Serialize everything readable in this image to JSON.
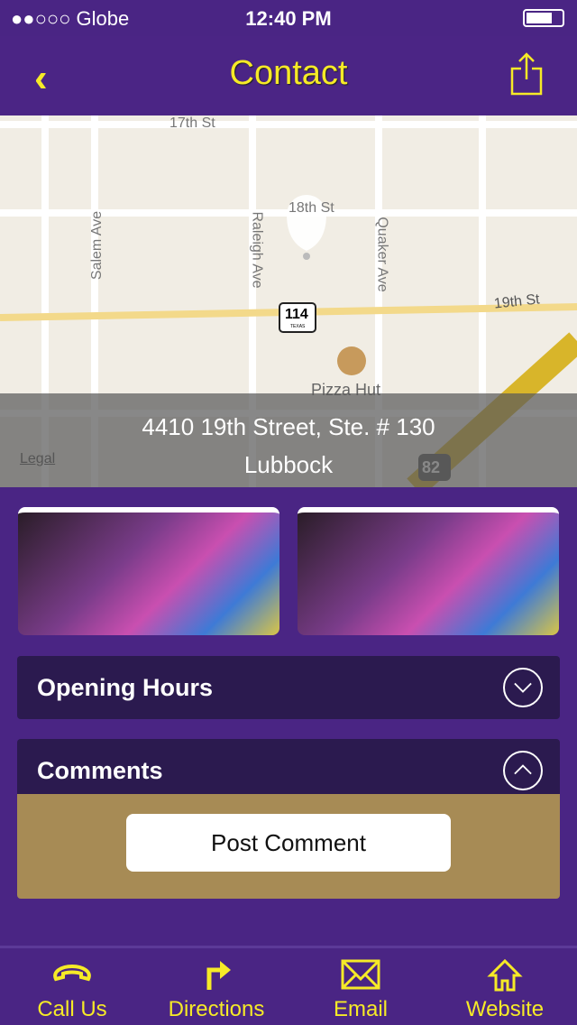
{
  "status": {
    "carrier": "●●○○○ Globe",
    "time": "12:40 PM"
  },
  "nav": {
    "title": "Contact",
    "back_icon": "chevron-left-icon",
    "share_icon": "share-icon"
  },
  "map": {
    "streets": [
      "17th St",
      "18th St",
      "19th St",
      "Salem Ave",
      "Raleigh Ave",
      "Quaker Ave"
    ],
    "highway_shield": "114",
    "highway_state": "TEXAS",
    "us_route": "82",
    "poi": "Pizza Hut",
    "legal": "Legal"
  },
  "address": {
    "line1": "4410 19th Street, Ste. # 130",
    "line2": "Lubbock"
  },
  "sections": {
    "opening_hours": "Opening Hours",
    "comments": "Comments",
    "post_comment": "Post Comment"
  },
  "tabs": [
    {
      "label": "Call Us",
      "icon": "phone-icon"
    },
    {
      "label": "Directions",
      "icon": "turn-right-arrow-icon"
    },
    {
      "label": "Email",
      "icon": "envelope-icon"
    },
    {
      "label": "Website",
      "icon": "home-icon"
    }
  ],
  "colors": {
    "purple": "#4a2584",
    "yellow": "#f6ea27",
    "gold": "#a78b55",
    "dark": "#2b1a4f"
  }
}
